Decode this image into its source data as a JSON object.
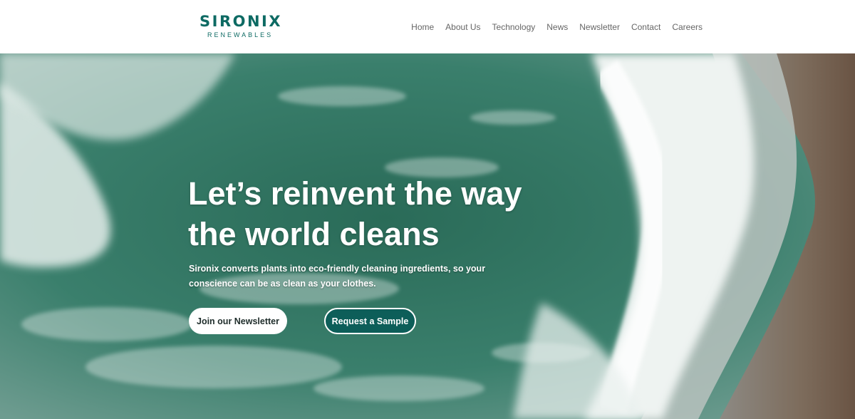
{
  "brand": {
    "name": "SIRONIX",
    "tagline": "RENEWABLES",
    "color": "#0d6a63"
  },
  "nav": {
    "items": [
      "Home",
      "About Us",
      "Technology",
      "News",
      "Newsletter",
      "Contact",
      "Careers"
    ]
  },
  "hero": {
    "title": "Let’s reinvent the way the world cleans",
    "subtitle": "Sironix converts plants into eco-friendly cleaning ingredients, so your conscience can be as clean as your clothes.",
    "buttons": {
      "newsletter": "Join our Newsletter",
      "sample": "Request a Sample"
    }
  },
  "colors": {
    "accent": "#0d5e59",
    "sea": "#2e6e5e",
    "nav_text": "#666666"
  }
}
